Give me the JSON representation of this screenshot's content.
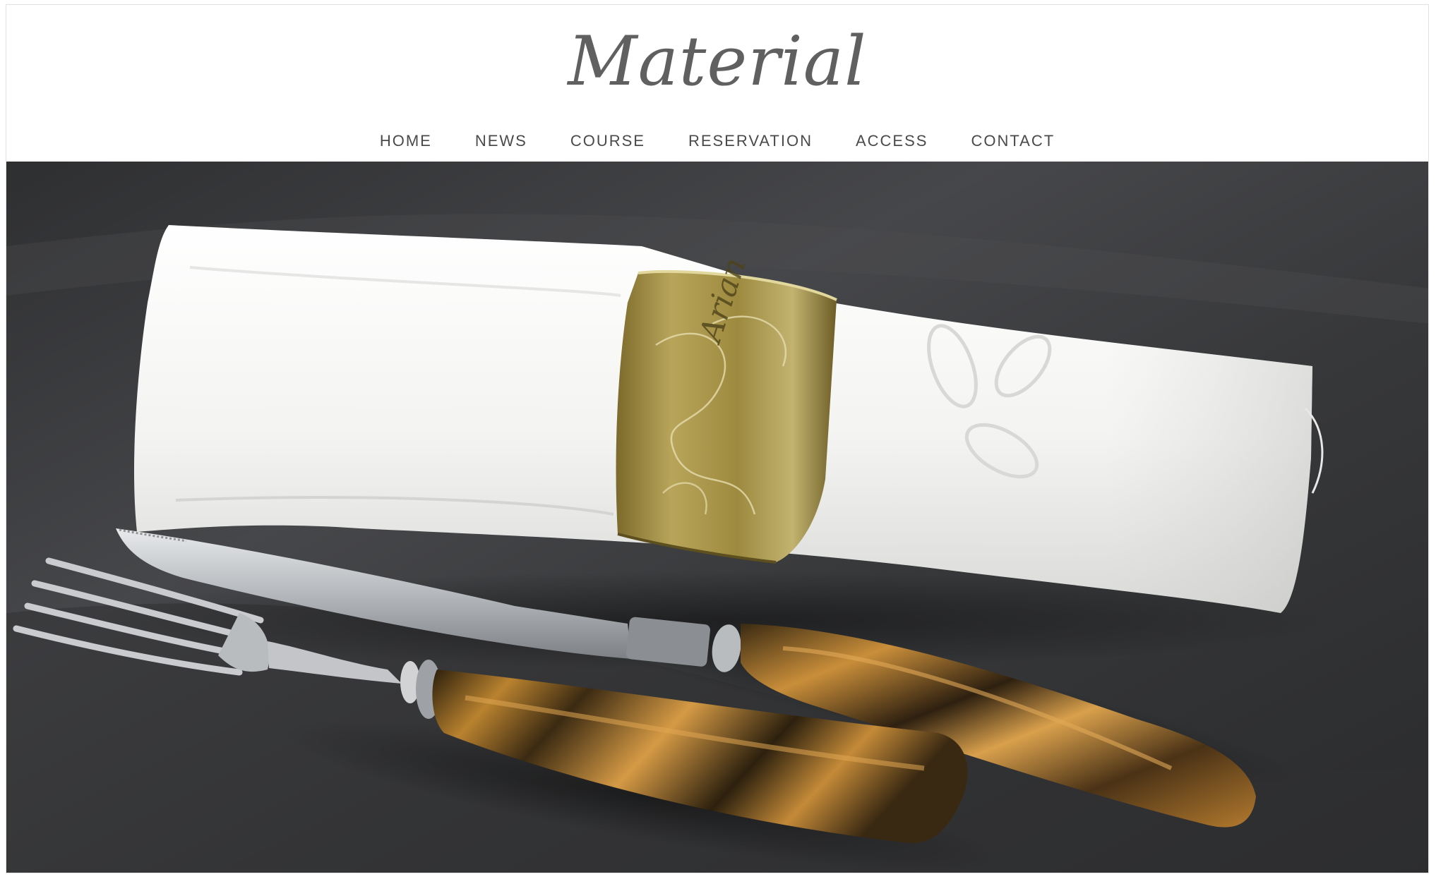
{
  "site": {
    "logo_text": "Material"
  },
  "nav": {
    "items": [
      {
        "label": "HOME"
      },
      {
        "label": "NEWS"
      },
      {
        "label": "COURSE"
      },
      {
        "label": "RESERVATION"
      },
      {
        "label": "ACCESS"
      },
      {
        "label": "CONTACT"
      }
    ]
  },
  "hero": {
    "ring_engraving": "Arian",
    "colors": {
      "tablecloth": "#3a3b3d",
      "napkin": "#f2f2f0",
      "ring": "#a9954a",
      "handle": "#b07a2c",
      "blade": "#c9cccf"
    }
  }
}
